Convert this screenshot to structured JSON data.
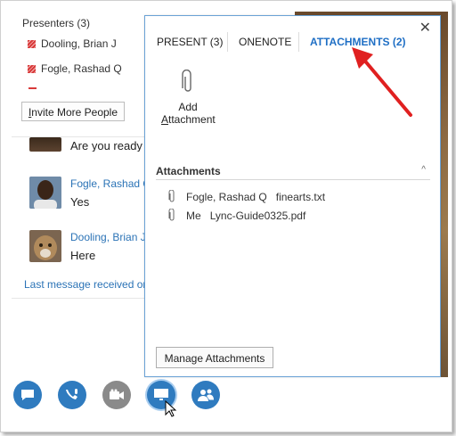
{
  "presenters": {
    "title": "Presenters (3)",
    "items": [
      "Dooling, Brian J",
      "Fogle, Rashad Q"
    ],
    "invite_label": "Invite More People"
  },
  "chat": {
    "partial_text": "Are you ready",
    "messages": [
      {
        "sender": "Fogle, Rashad Q",
        "text": "Yes"
      },
      {
        "sender": "Dooling, Brian J",
        "text": "Here"
      }
    ],
    "last_message": "Last message received on"
  },
  "popup": {
    "tabs": [
      {
        "label": "PRESENT (3)",
        "active": false
      },
      {
        "label": "ONENOTE",
        "active": false
      },
      {
        "label": "ATTACHMENTS (2)",
        "active": true
      }
    ],
    "close_icon": "close-icon",
    "add_attachment": {
      "line1": "Add",
      "line2_prefix": "A",
      "line2_rest": "ttachment"
    },
    "section_title": "Attachments",
    "attachments": [
      {
        "owner": "Fogle, Rashad Q",
        "file": "finearts.txt"
      },
      {
        "owner": "Me",
        "file": "Lync-Guide0325.pdf"
      }
    ],
    "manage_label": "Manage Attachments"
  },
  "toolbar": {
    "buttons": [
      "im-icon",
      "mic-icon",
      "video-icon",
      "present-icon",
      "people-icon"
    ]
  },
  "colors": {
    "accent": "#1f6fc5",
    "button_blue": "#2f7bbf",
    "arrow": "#e02020"
  }
}
